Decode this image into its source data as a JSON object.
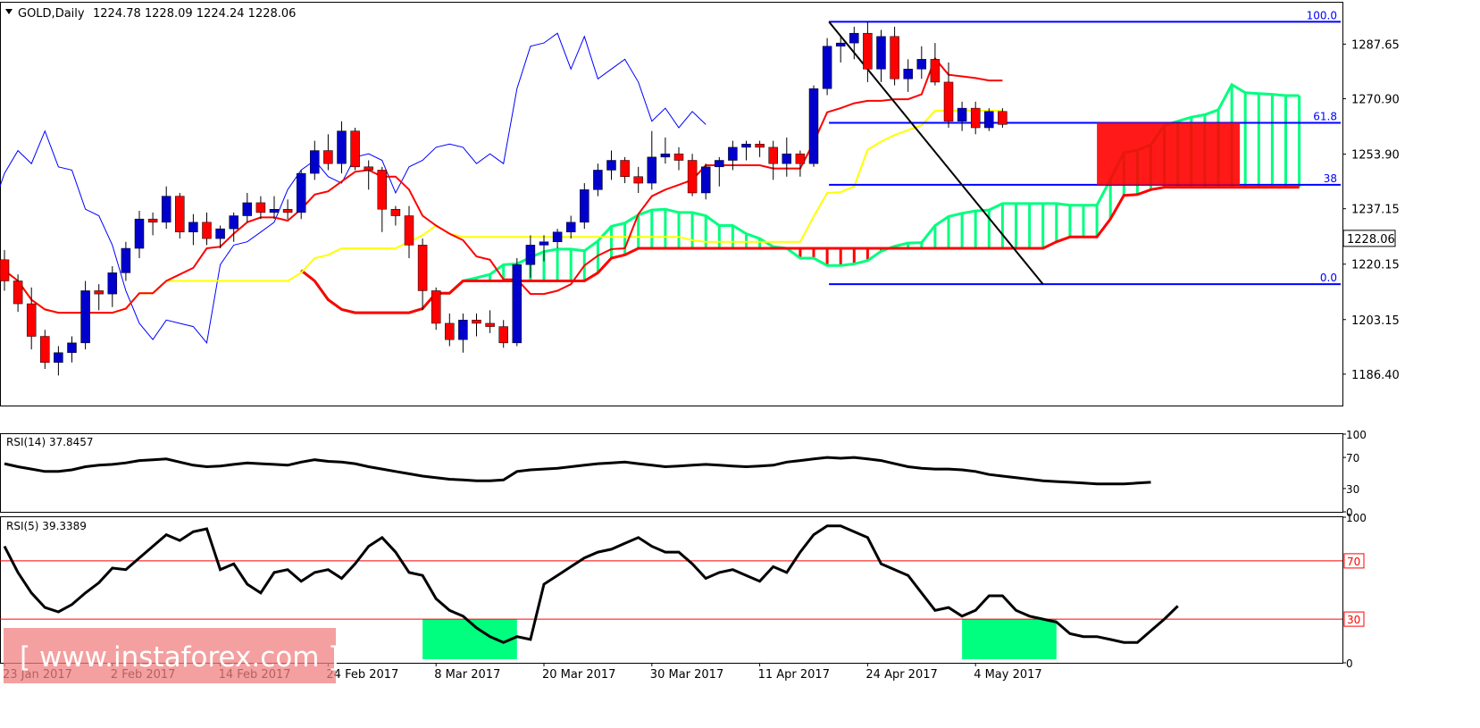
{
  "header": {
    "symbol": "GOLD,Daily",
    "ohlc": "1224.78 1228.09 1224.24 1228.06",
    "current_price": "1228.06"
  },
  "watermark": {
    "text": "[ www.instaforex.com ]"
  },
  "colors": {
    "bull_candle": "#0000cc",
    "bear_candle": "#ff0000",
    "tenkan": "#ff0000",
    "kijun": "#ff0000",
    "senkou_a_cloud": "#00ff7f",
    "senkou_b_cloud": "#ff0000",
    "chikou": "#0000ff",
    "ma_yellow": "#ffff00",
    "fib_line": "#0000ff",
    "rsi_line": "#000000",
    "rsi_level": "#ff0000",
    "highlight": "#00ff7f",
    "watermark_bg": "#f08080"
  },
  "chart_data": {
    "type": "candlestick",
    "instrument": "GOLD",
    "timeframe": "Daily",
    "x_labels": [
      "23 Jan 2017",
      "2 Feb 2017",
      "14 Feb 2017",
      "24 Feb 2017",
      "8 Mar 2017",
      "20 Mar 2017",
      "30 Mar 2017",
      "11 Apr 2017",
      "24 Apr 2017",
      "4 May 2017"
    ],
    "x_label_index": [
      0,
      8,
      16,
      24,
      32,
      40,
      48,
      56,
      64,
      72
    ],
    "price_axis": {
      "ticks": [
        "1287.65",
        "1270.90",
        "1253.90",
        "1237.15",
        "1220.15",
        "1203.15",
        "1186.40"
      ],
      "ylim": [
        1176.5,
        1299
      ]
    },
    "candles": [
      [
        1221.5,
        1224.5,
        1212.0,
        1215.0
      ],
      [
        1215.0,
        1217.0,
        1205.5,
        1208.0
      ],
      [
        1208.0,
        1213.0,
        1194.0,
        1198.0
      ],
      [
        1198.0,
        1200.0,
        1188.0,
        1190.0
      ],
      [
        1190.0,
        1195.0,
        1186.0,
        1193.0
      ],
      [
        1193.0,
        1198.0,
        1190.0,
        1196.0
      ],
      [
        1196.0,
        1215.0,
        1194.0,
        1212.0
      ],
      [
        1212.0,
        1214.0,
        1206.0,
        1211.0
      ],
      [
        1211.0,
        1219.5,
        1207.0,
        1217.5
      ],
      [
        1217.5,
        1227.0,
        1215.0,
        1225.0
      ],
      [
        1225.0,
        1236.5,
        1222.0,
        1234.0
      ],
      [
        1234.0,
        1236.0,
        1229.0,
        1233.0
      ],
      [
        1233.0,
        1244.0,
        1231.0,
        1241.0
      ],
      [
        1241.0,
        1242.0,
        1228.0,
        1230.0
      ],
      [
        1230.0,
        1235.5,
        1226.0,
        1233.0
      ],
      [
        1233.0,
        1236.0,
        1226.0,
        1228.0
      ],
      [
        1228.0,
        1232.0,
        1225.0,
        1231.0
      ],
      [
        1231.0,
        1236.0,
        1227.0,
        1235.0
      ],
      [
        1235.0,
        1242.0,
        1233.0,
        1239.0
      ],
      [
        1239.0,
        1241.0,
        1234.0,
        1236.0
      ],
      [
        1236.0,
        1241.0,
        1234.0,
        1237.0
      ],
      [
        1237.0,
        1240.0,
        1234.0,
        1236.0
      ],
      [
        1236.0,
        1249.0,
        1234.0,
        1248.0
      ],
      [
        1248.0,
        1258.0,
        1246.0,
        1255.0
      ],
      [
        1255.0,
        1260.0,
        1249.0,
        1251.0
      ],
      [
        1251.0,
        1264.0,
        1248.0,
        1261.0
      ],
      [
        1261.0,
        1262.0,
        1249.0,
        1250.0
      ],
      [
        1250.0,
        1252.0,
        1243.0,
        1249.0
      ],
      [
        1249.0,
        1250.0,
        1230.0,
        1237.0
      ],
      [
        1237.0,
        1238.0,
        1232.0,
        1235.0
      ],
      [
        1235.0,
        1238.0,
        1222.0,
        1226.0
      ],
      [
        1226.0,
        1228.0,
        1206.0,
        1212.0
      ],
      [
        1212.0,
        1213.0,
        1200.0,
        1202.0
      ],
      [
        1202.0,
        1205.0,
        1195.0,
        1197.0
      ],
      [
        1197.0,
        1205.0,
        1193.0,
        1203.0
      ],
      [
        1203.0,
        1205.0,
        1198.0,
        1202.0
      ],
      [
        1202.0,
        1206.0,
        1199.0,
        1201.0
      ],
      [
        1201.0,
        1203.0,
        1194.5,
        1196.0
      ],
      [
        1196.0,
        1222.0,
        1195.0,
        1220.0
      ],
      [
        1220.0,
        1229.0,
        1216.0,
        1226.0
      ],
      [
        1226.0,
        1229.0,
        1221.0,
        1227.0
      ],
      [
        1227.0,
        1231.0,
        1225.0,
        1230.0
      ],
      [
        1230.0,
        1235.0,
        1228.0,
        1233.0
      ],
      [
        1233.0,
        1245.0,
        1231.0,
        1243.0
      ],
      [
        1243.0,
        1251.0,
        1241.0,
        1249.0
      ],
      [
        1249.0,
        1255.0,
        1246.0,
        1252.0
      ],
      [
        1252.0,
        1253.0,
        1245.0,
        1247.0
      ],
      [
        1247.0,
        1250.0,
        1242.0,
        1245.0
      ],
      [
        1245.0,
        1261.0,
        1243.0,
        1253.0
      ],
      [
        1253.0,
        1259.0,
        1251.0,
        1254.0
      ],
      [
        1254.0,
        1256.0,
        1249.0,
        1252.0
      ],
      [
        1252.0,
        1254.0,
        1241.0,
        1242.0
      ],
      [
        1242.0,
        1251.0,
        1240.0,
        1250.0
      ],
      [
        1250.0,
        1253.0,
        1244.0,
        1252.0
      ],
      [
        1252.0,
        1258.0,
        1249.0,
        1256.0
      ],
      [
        1256.0,
        1258.0,
        1252.0,
        1257.0
      ],
      [
        1257.0,
        1258.0,
        1253.0,
        1256.0
      ],
      [
        1256.0,
        1258.0,
        1246.0,
        1251.0
      ],
      [
        1251.0,
        1259.0,
        1247.0,
        1254.0
      ],
      [
        1254.0,
        1255.0,
        1247.0,
        1251.0
      ],
      [
        1251.0,
        1275.0,
        1250.0,
        1274.0
      ],
      [
        1274.0,
        1289.5,
        1272.0,
        1287.0
      ],
      [
        1287.0,
        1290.0,
        1282.0,
        1288.0
      ],
      [
        1288.0,
        1293.0,
        1283.0,
        1291.0
      ],
      [
        1291.0,
        1294.5,
        1276.0,
        1280.0
      ],
      [
        1280.0,
        1292.0,
        1276.0,
        1290.0
      ],
      [
        1290.0,
        1293.0,
        1275.0,
        1277.0
      ],
      [
        1277.0,
        1283.0,
        1273.0,
        1280.0
      ],
      [
        1280.0,
        1287.0,
        1277.0,
        1283.0
      ],
      [
        1283.0,
        1288.0,
        1275.0,
        1276.0
      ],
      [
        1276.0,
        1282.0,
        1262.0,
        1264.0
      ],
      [
        1264.0,
        1270.0,
        1261.0,
        1268.0
      ],
      [
        1268.0,
        1270.0,
        1260.0,
        1262.0
      ],
      [
        1262.0,
        1268.0,
        1261.0,
        1267.0
      ],
      [
        1267.0,
        1268.0,
        1262.0,
        1263.0
      ]
    ],
    "fibonacci": {
      "levels": [
        {
          "label": "100.0",
          "price": 1294.5
        },
        {
          "label": "61.8",
          "price": 1263.5
        },
        {
          "label": "38",
          "price": 1244.5
        },
        {
          "label": "0.0",
          "price": 1214.0
        }
      ]
    },
    "rsi14": {
      "label": "RSI(14) 37.8457",
      "value": 37.8457,
      "ticks": [
        100,
        70,
        30,
        0
      ],
      "values": [
        62,
        58,
        55,
        52,
        52,
        54,
        58,
        60,
        61,
        63,
        66,
        67,
        68,
        64,
        60,
        58,
        59,
        61,
        63,
        62,
        61,
        60,
        64,
        67,
        65,
        64,
        62,
        58,
        55,
        52,
        49,
        46,
        44,
        42,
        41,
        40,
        40,
        41,
        52,
        54,
        55,
        56,
        58,
        60,
        62,
        63,
        64,
        62,
        60,
        58,
        59,
        60,
        61,
        60,
        59,
        58,
        59,
        60,
        64,
        66,
        68,
        70,
        69,
        70,
        68,
        66,
        62,
        58,
        56,
        55,
        55,
        54,
        52,
        48,
        46,
        44,
        42,
        40,
        39,
        38,
        37,
        36,
        36,
        36,
        37,
        38
      ]
    },
    "rsi5": {
      "label": "RSI(5) 39.3389",
      "value": 39.3389,
      "ticks": [
        "100",
        "70",
        "30",
        "0"
      ],
      "levels": [
        70,
        30
      ],
      "values": [
        80,
        62,
        48,
        38,
        35,
        40,
        48,
        55,
        65,
        64,
        72,
        80,
        88,
        84,
        90,
        92,
        64,
        68,
        54,
        48,
        62,
        64,
        56,
        62,
        64,
        58,
        68,
        80,
        86,
        76,
        62,
        60,
        44,
        36,
        32,
        24,
        18,
        14,
        18,
        16,
        54,
        60,
        66,
        72,
        76,
        78,
        82,
        86,
        80,
        76,
        76,
        68,
        58,
        62,
        64,
        60,
        56,
        66,
        62,
        76,
        88,
        94,
        94,
        90,
        86,
        68,
        64,
        60,
        48,
        36,
        38,
        32,
        36,
        46,
        46,
        36,
        32,
        30,
        28,
        20,
        18,
        18,
        16,
        14,
        14,
        22,
        30,
        39
      ]
    },
    "highlights": [
      {
        "from": "8 Mar 2017",
        "to": "mid Mar 2017"
      },
      {
        "from": "late Apr 2017",
        "to": "8 May 2017"
      }
    ]
  }
}
